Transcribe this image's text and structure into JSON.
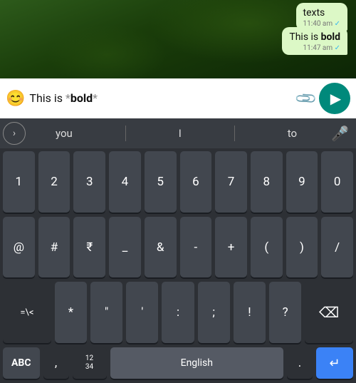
{
  "chat": {
    "bg": "green field",
    "bubble1": {
      "prefix": "texts",
      "time": "11:40 am",
      "check": "✓"
    },
    "bubble2": {
      "prefix": "This is ",
      "bold": "bold",
      "time": "11:47 am",
      "check": "✓"
    }
  },
  "inputBar": {
    "emoji": "😊",
    "text_prefix": "This is ",
    "text_asterisk1": "*",
    "text_bold": "bold",
    "text_asterisk2": "*",
    "attach_label": "📎",
    "send_label": "➤"
  },
  "suggestions": {
    "arrow": ">",
    "words": [
      "you",
      "I",
      "to"
    ],
    "mic": "🎤"
  },
  "keyboard": {
    "row1": [
      "1",
      "2",
      "3",
      "4",
      "5",
      "6",
      "7",
      "8",
      "9",
      "0"
    ],
    "row2": [
      "@",
      "#",
      "₹",
      "_",
      "&",
      "-",
      "+",
      "(",
      ")",
      "/"
    ],
    "row3_left": "=\\<",
    "row3_mid": [
      "*",
      "\"",
      "'",
      ":",
      ";",
      "!",
      "?"
    ],
    "row3_right": "⌫",
    "bottom": {
      "abc": "ABC",
      "comma": ",",
      "num_layout": "12\n34",
      "lang": "English",
      "period": ".",
      "enter": "↵"
    }
  }
}
